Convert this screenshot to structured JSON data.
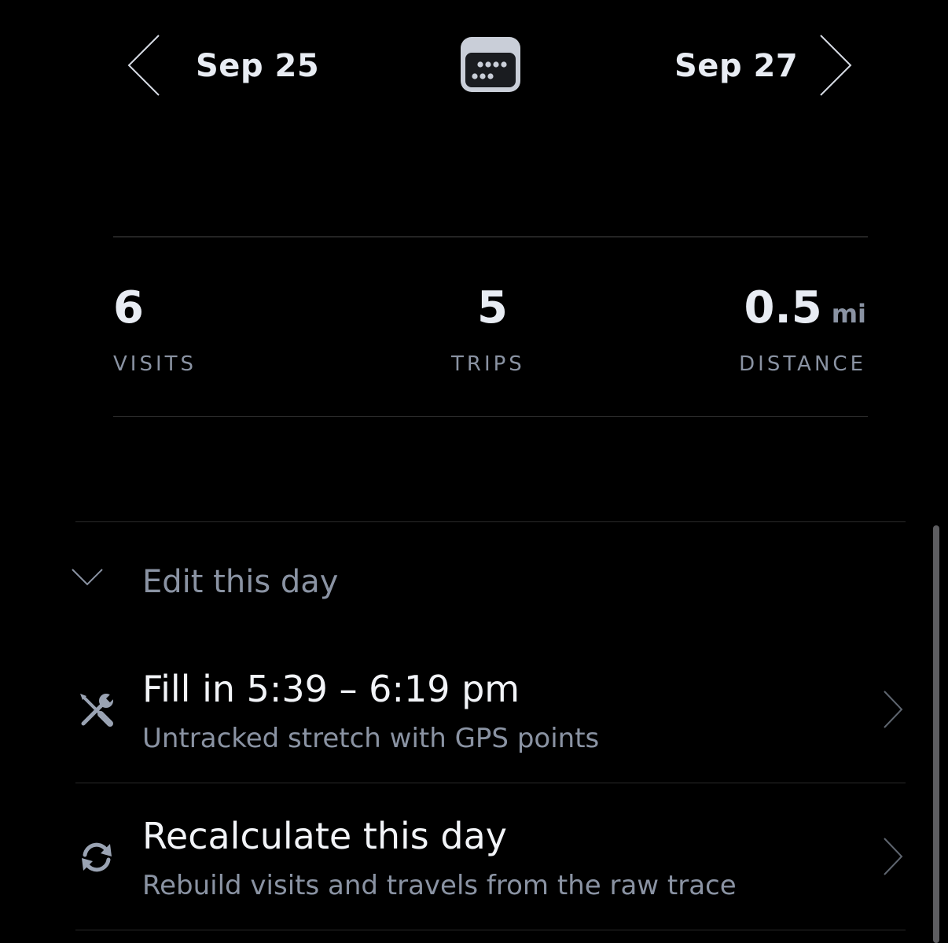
{
  "date_nav": {
    "prev_date": "Sep 25",
    "next_date": "Sep 27",
    "prev_icon": "chevron-left-icon",
    "next_icon": "chevron-right-icon",
    "calendar_icon": "calendar-icon"
  },
  "stats": {
    "visits": {
      "value": "6",
      "label": "VISITS"
    },
    "trips": {
      "value": "5",
      "label": "TRIPS"
    },
    "distance": {
      "value": "0.5",
      "unit": "mi",
      "label": "DISTANCE"
    }
  },
  "edit_section": {
    "title": "Edit this day",
    "toggle_icon": "chevron-down-icon",
    "actions": [
      {
        "title": "Fill in 5:39 – 6:19 pm",
        "subtitle": "Untracked stretch with GPS points",
        "icon": "tools-icon"
      },
      {
        "title": "Recalculate this day",
        "subtitle": "Rebuild visits and travels from the raw trace",
        "icon": "refresh-icon"
      }
    ]
  },
  "colors": {
    "background": "#000000",
    "primary_text": "#e8ecf3",
    "secondary_text": "#8a93a3",
    "divider": "#2a2a2a",
    "icon_gray": "#9aa3b3"
  }
}
